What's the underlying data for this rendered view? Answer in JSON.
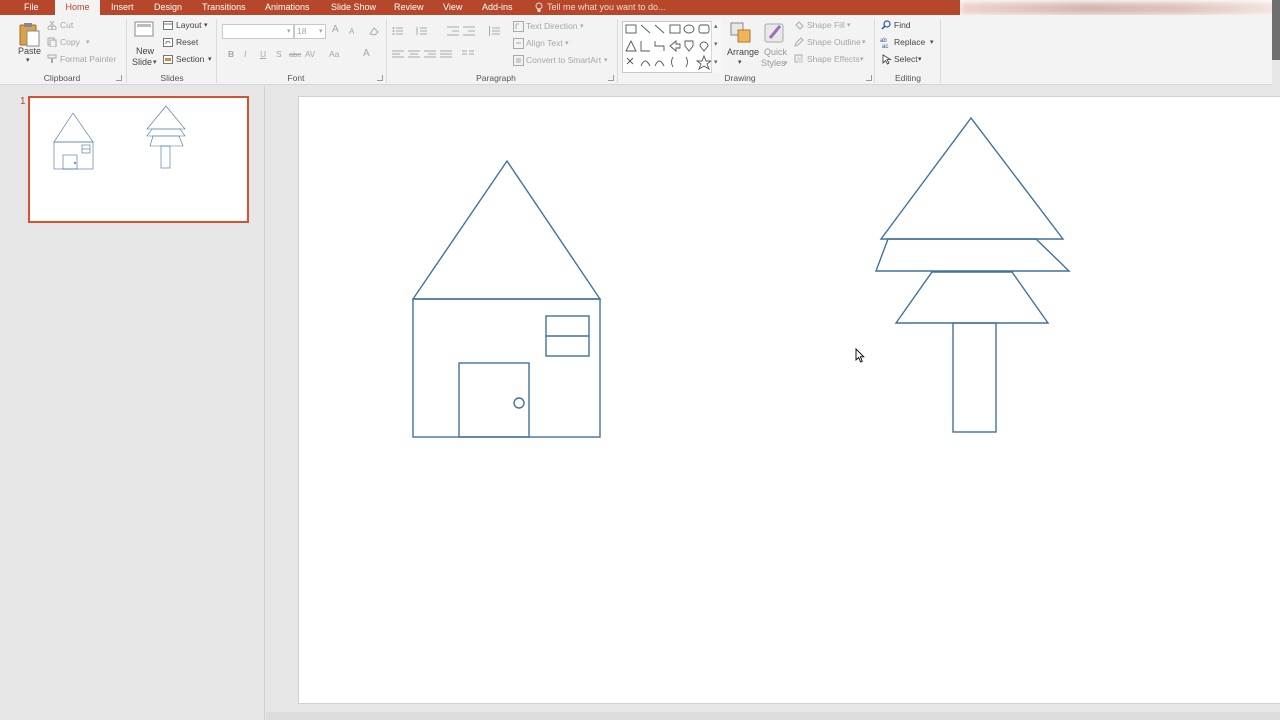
{
  "tabs": [
    {
      "label": "File"
    },
    {
      "label": "Home"
    },
    {
      "label": "Insert"
    },
    {
      "label": "Design"
    },
    {
      "label": "Transitions"
    },
    {
      "label": "Animations"
    },
    {
      "label": "Slide Show"
    },
    {
      "label": "Review"
    },
    {
      "label": "View"
    },
    {
      "label": "Add-ins"
    }
  ],
  "tell_me": "Tell me what you want to do...",
  "clipboard": {
    "paste": "Paste",
    "cut": "Cut",
    "copy": "Copy",
    "format_painter": "Format Painter",
    "group": "Clipboard"
  },
  "slides_group": {
    "new_slide_1": "New",
    "new_slide_2": "Slide",
    "layout": "Layout",
    "reset": "Reset",
    "section": "Section",
    "group": "Slides"
  },
  "font": {
    "size": "18",
    "bold": "B",
    "italic": "I",
    "underline": "U",
    "shadow": "S",
    "strike": "abc",
    "spacing": "AV",
    "case": "Aa",
    "color": "A",
    "grow": "A",
    "shrink": "A",
    "group": "Font"
  },
  "paragraph": {
    "text_direction": "Text Direction",
    "align_text": "Align Text",
    "convert_smartart": "Convert to SmartArt",
    "group": "Paragraph"
  },
  "drawing": {
    "arrange": "Arrange",
    "quick_1": "Quick",
    "quick_2": "Styles",
    "shape_fill": "Shape Fill",
    "shape_outline": "Shape Outline",
    "shape_effects": "Shape Effects",
    "group": "Drawing"
  },
  "editing": {
    "find": "Find",
    "replace": "Replace",
    "select": "Select",
    "group": "Editing"
  },
  "slide_number": "1",
  "colors": {
    "accent": "#b7472a",
    "shape_outline": "#41719c"
  }
}
